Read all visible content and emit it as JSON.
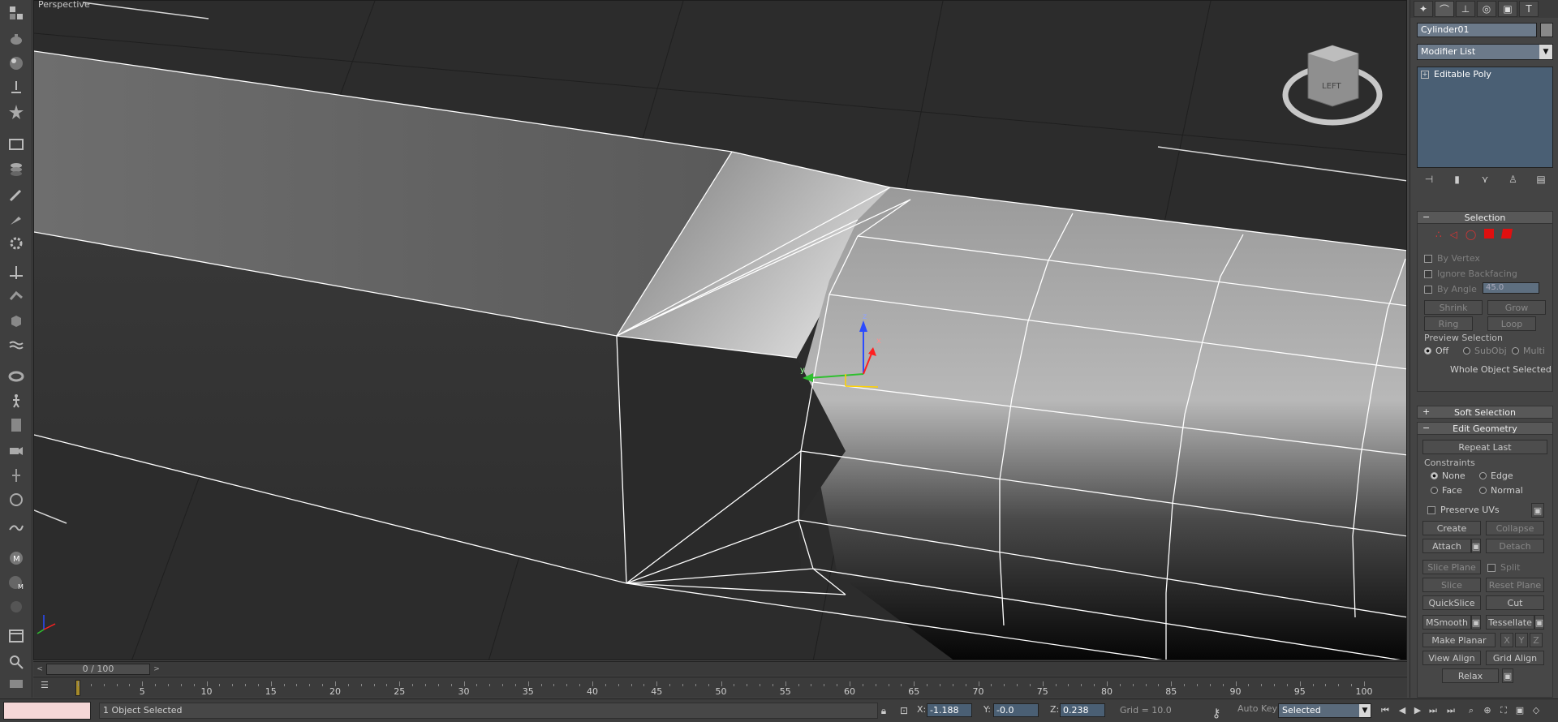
{
  "viewport": {
    "label": "Perspective",
    "viewcube_face": "LEFT"
  },
  "gizmo": {
    "x": "x",
    "y": "y",
    "z": "z"
  },
  "command_panel": {
    "object_name": "Cylinder01",
    "modifier_list": "Modifier List",
    "stack_items": [
      "Editable Poly"
    ],
    "selection": {
      "title": "Selection",
      "by_vertex": "By Vertex",
      "ignore_backfacing": "Ignore Backfacing",
      "by_angle": "By Angle",
      "angle_value": "45.0",
      "shrink": "Shrink",
      "grow": "Grow",
      "ring": "Ring",
      "loop": "Loop",
      "preview_selection": "Preview Selection",
      "preview_options": [
        "Off",
        "SubObj",
        "Multi"
      ],
      "status": "Whole Object Selected"
    },
    "soft_selection": {
      "title": "Soft Selection"
    },
    "edit_geometry": {
      "title": "Edit Geometry",
      "repeat_last": "Repeat Last",
      "constraints_label": "Constraints",
      "constraints": [
        "None",
        "Edge",
        "Face",
        "Normal"
      ],
      "preserve_uvs": "Preserve UVs",
      "create": "Create",
      "collapse": "Collapse",
      "attach": "Attach",
      "detach": "Detach",
      "slice_plane": "Slice Plane",
      "split": "Split",
      "slice": "Slice",
      "reset_plane": "Reset Plane",
      "quickslice": "QuickSlice",
      "cut": "Cut",
      "msmooth": "MSmooth",
      "tessellate": "Tessellate",
      "make_planar": "Make Planar",
      "x": "X",
      "y": "Y",
      "z": "Z",
      "view_align": "View Align",
      "grid_align": "Grid Align",
      "relax": "Relax"
    }
  },
  "timeline": {
    "slider": "0 / 100",
    "ticks": [
      "5",
      "10",
      "15",
      "20",
      "25",
      "30",
      "35",
      "40",
      "45",
      "50",
      "55",
      "60",
      "65",
      "70",
      "75",
      "80",
      "85",
      "90",
      "95",
      "100"
    ]
  },
  "status_bar": {
    "message": "1 Object Selected",
    "x_label": "X:",
    "x_value": "-1.188",
    "y_label": "Y:",
    "y_value": "-0.0",
    "z_label": "Z:",
    "z_value": "0.238",
    "grid": "Grid = 10.0",
    "auto_key": "Auto Key",
    "selection_set": "Selected"
  }
}
